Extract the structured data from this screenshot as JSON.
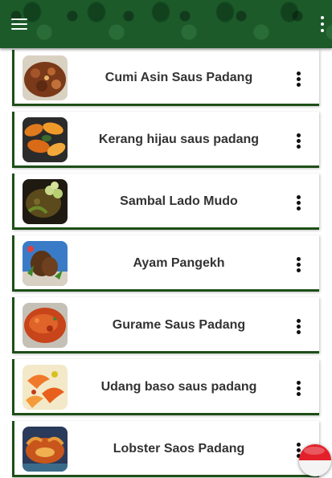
{
  "appbar": {
    "menu_icon": "hamburger-menu-icon",
    "overflow_icon": "vertical-dots-icon",
    "color": "#1c5a2a"
  },
  "recipes": [
    {
      "title": "Cumi Asin Saus Padang",
      "image": "squid-dish-thumbnail"
    },
    {
      "title": "Kerang hijau saus padang",
      "image": "green-mussel-dish-thumbnail"
    },
    {
      "title": "Sambal Lado Mudo",
      "image": "green-chili-sambal-thumbnail"
    },
    {
      "title": "Ayam Pangekh",
      "image": "chicken-dish-thumbnail"
    },
    {
      "title": "Gurame Saus Padang",
      "image": "gourami-fish-dish-thumbnail"
    },
    {
      "title": "Udang baso saus padang",
      "image": "shrimp-dish-thumbnail"
    },
    {
      "title": "Lobster Saos Padang",
      "image": "lobster-dish-thumbnail"
    }
  ],
  "item_menu_icon": "more-vertical-icon",
  "card_accent": "#1d4f17",
  "language_flag": "indonesia-flag-icon"
}
